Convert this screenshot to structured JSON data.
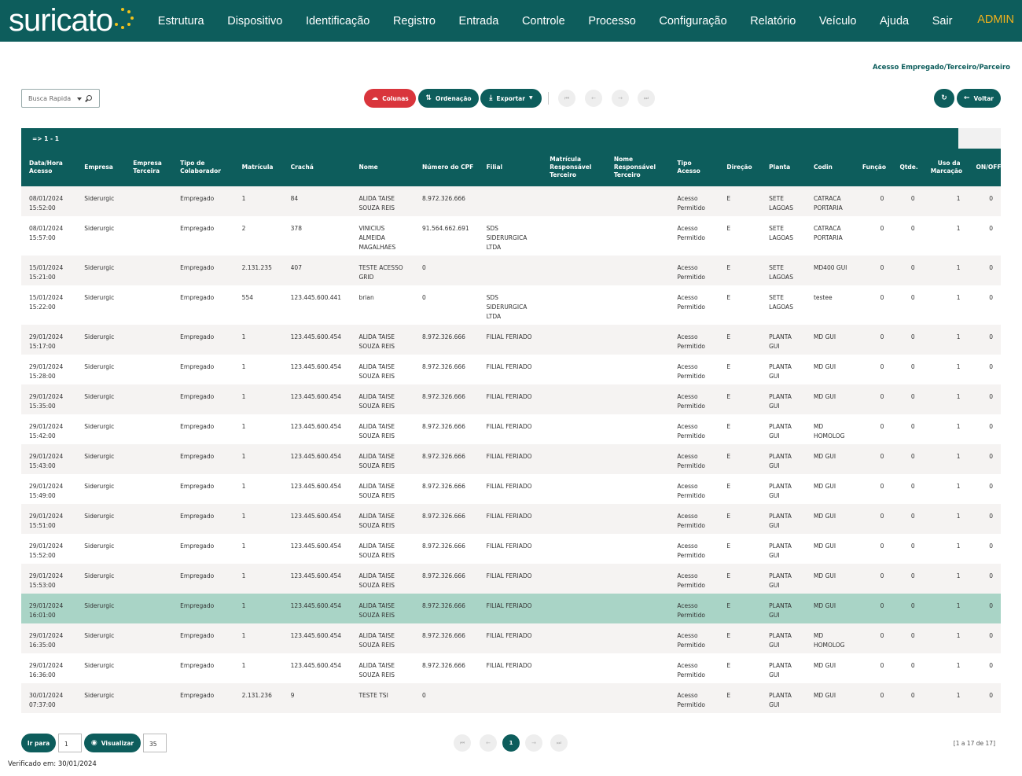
{
  "app": {
    "brand": "suricato",
    "nav": [
      "Estrutura",
      "Dispositivo",
      "Identificação",
      "Registro",
      "Entrada",
      "Controle",
      "Processo",
      "Configuração",
      "Relatório",
      "Veículo",
      "Ajuda",
      "Sair"
    ],
    "user": "ADMIN",
    "accent": "#0d5d5c",
    "highlight": "#f4b21b"
  },
  "page": {
    "subtitle": "Acesso Empregado/Terceiro/Parceiro"
  },
  "toolbar": {
    "search_placeholder": "Busca Rapida",
    "columns": "Colunas",
    "order": "Ordenação",
    "export": "Exportar",
    "back": "Voltar"
  },
  "table": {
    "range": "=> 1 - 1",
    "headers": [
      "Data/Hora Acesso",
      "Empresa",
      "Empresa Terceira",
      "Tipo de Colaborador",
      "Matrícula",
      "Crachá",
      "Nome",
      "Número do CPF",
      "Filial",
      "Matrícula Responsável Terceiro",
      "Nome Responsável Terceiro",
      "Tipo Acesso",
      "Direção",
      "Planta",
      "Codin",
      "Função",
      "Qtde.",
      "Uso da Marcação",
      "ON/OFF"
    ],
    "rows": [
      [
        "08/01/2024 15:52:00",
        "Siderurgic",
        "",
        "Empregado",
        "1",
        "84",
        "ALIDA TAISE SOUZA REIS",
        "8.972.326.666",
        "",
        "",
        "",
        "Acesso Permitido",
        "E",
        "SETE LAGOAS",
        "CATRACA PORTARIA",
        "0",
        "0",
        "1",
        "0"
      ],
      [
        "08/01/2024 15:57:00",
        "Siderurgic",
        "",
        "Empregado",
        "2",
        "378",
        "VINICIUS ALMEIDA MAGALHAES",
        "91.564.662.691",
        "SDS SIDERURGICA LTDA",
        "",
        "",
        "Acesso Permitido",
        "E",
        "SETE LAGOAS",
        "CATRACA PORTARIA",
        "0",
        "0",
        "1",
        "0"
      ],
      [
        "15/01/2024 15:21:00",
        "Siderurgic",
        "",
        "Empregado",
        "2.131.235",
        "407",
        "TESTE ACESSO GRID",
        "0",
        "",
        "",
        "",
        "Acesso Permitido",
        "E",
        "SETE LAGOAS",
        "MD400 GUI",
        "0",
        "0",
        "1",
        "0"
      ],
      [
        "15/01/2024 15:22:00",
        "Siderurgic",
        "",
        "Empregado",
        "554",
        "123.445.600.441",
        "brian",
        "0",
        "SDS SIDERURGICA LTDA",
        "",
        "",
        "Acesso Permitido",
        "E",
        "SETE LAGOAS",
        "testee",
        "0",
        "0",
        "1",
        "0"
      ],
      [
        "29/01/2024 15:17:00",
        "Siderurgic",
        "",
        "Empregado",
        "1",
        "123.445.600.454",
        "ALIDA TAISE SOUZA REIS",
        "8.972.326.666",
        "FILIAL FERIADO",
        "",
        "",
        "Acesso Permitido",
        "E",
        "PLANTA GUI",
        "MD GUI",
        "0",
        "0",
        "1",
        "0"
      ],
      [
        "29/01/2024 15:28:00",
        "Siderurgic",
        "",
        "Empregado",
        "1",
        "123.445.600.454",
        "ALIDA TAISE SOUZA REIS",
        "8.972.326.666",
        "FILIAL FERIADO",
        "",
        "",
        "Acesso Permitido",
        "E",
        "PLANTA GUI",
        "MD GUI",
        "0",
        "0",
        "1",
        "0"
      ],
      [
        "29/01/2024 15:35:00",
        "Siderurgic",
        "",
        "Empregado",
        "1",
        "123.445.600.454",
        "ALIDA TAISE SOUZA REIS",
        "8.972.326.666",
        "FILIAL FERIADO",
        "",
        "",
        "Acesso Permitido",
        "E",
        "PLANTA GUI",
        "MD GUI",
        "0",
        "0",
        "1",
        "0"
      ],
      [
        "29/01/2024 15:42:00",
        "Siderurgic",
        "",
        "Empregado",
        "1",
        "123.445.600.454",
        "ALIDA TAISE SOUZA REIS",
        "8.972.326.666",
        "FILIAL FERIADO",
        "",
        "",
        "Acesso Permitido",
        "E",
        "PLANTA GUI",
        "MD HOMOLOG",
        "0",
        "0",
        "1",
        "0"
      ],
      [
        "29/01/2024 15:43:00",
        "Siderurgic",
        "",
        "Empregado",
        "1",
        "123.445.600.454",
        "ALIDA TAISE SOUZA REIS",
        "8.972.326.666",
        "FILIAL FERIADO",
        "",
        "",
        "Acesso Permitido",
        "E",
        "PLANTA GUI",
        "MD GUI",
        "0",
        "0",
        "1",
        "0"
      ],
      [
        "29/01/2024 15:49:00",
        "Siderurgic",
        "",
        "Empregado",
        "1",
        "123.445.600.454",
        "ALIDA TAISE SOUZA REIS",
        "8.972.326.666",
        "FILIAL FERIADO",
        "",
        "",
        "Acesso Permitido",
        "E",
        "PLANTA GUI",
        "MD GUI",
        "0",
        "0",
        "1",
        "0"
      ],
      [
        "29/01/2024 15:51:00",
        "Siderurgic",
        "",
        "Empregado",
        "1",
        "123.445.600.454",
        "ALIDA TAISE SOUZA REIS",
        "8.972.326.666",
        "FILIAL FERIADO",
        "",
        "",
        "Acesso Permitido",
        "E",
        "PLANTA GUI",
        "MD GUI",
        "0",
        "0",
        "1",
        "0"
      ],
      [
        "29/01/2024 15:52:00",
        "Siderurgic",
        "",
        "Empregado",
        "1",
        "123.445.600.454",
        "ALIDA TAISE SOUZA REIS",
        "8.972.326.666",
        "FILIAL FERIADO",
        "",
        "",
        "Acesso Permitido",
        "E",
        "PLANTA GUI",
        "MD GUI",
        "0",
        "0",
        "1",
        "0"
      ],
      [
        "29/01/2024 15:53:00",
        "Siderurgic",
        "",
        "Empregado",
        "1",
        "123.445.600.454",
        "ALIDA TAISE SOUZA REIS",
        "8.972.326.666",
        "FILIAL FERIADO",
        "",
        "",
        "Acesso Permitido",
        "E",
        "PLANTA GUI",
        "MD GUI",
        "0",
        "0",
        "1",
        "0"
      ],
      [
        "29/01/2024 16:01:00",
        "Siderurgic",
        "",
        "Empregado",
        "1",
        "123.445.600.454",
        "ALIDA TAISE SOUZA REIS",
        "8.972.326.666",
        "FILIAL FERIADO",
        "",
        "",
        "Acesso Permitido",
        "E",
        "PLANTA GUI",
        "MD GUI",
        "0",
        "0",
        "1",
        "0"
      ],
      [
        "29/01/2024 16:35:00",
        "Siderurgic",
        "",
        "Empregado",
        "1",
        "123.445.600.454",
        "ALIDA TAISE SOUZA REIS",
        "8.972.326.666",
        "FILIAL FERIADO",
        "",
        "",
        "Acesso Permitido",
        "E",
        "PLANTA GUI",
        "MD HOMOLOG",
        "0",
        "0",
        "1",
        "0"
      ],
      [
        "29/01/2024 16:36:00",
        "Siderurgic",
        "",
        "Empregado",
        "1",
        "123.445.600.454",
        "ALIDA TAISE SOUZA REIS",
        "8.972.326.666",
        "FILIAL FERIADO",
        "",
        "",
        "Acesso Permitido",
        "E",
        "PLANTA GUI",
        "MD GUI",
        "0",
        "0",
        "1",
        "0"
      ],
      [
        "30/01/2024 07:37:00",
        "Siderurgic",
        "",
        "Empregado",
        "2.131.236",
        "9",
        "TESTE TSI",
        "0",
        "",
        "",
        "",
        "Acesso Permitido",
        "E",
        "PLANTA GUI",
        "MD GUI",
        "0",
        "0",
        "1",
        "0"
      ]
    ],
    "selected_row": 13,
    "selected_color": "#a9d4c6"
  },
  "footer": {
    "goto_label": "Ir para",
    "goto_value": "1",
    "view_label": "Visualizar",
    "view_value": "35",
    "current_page": "1",
    "count": "[1 a 17 de 17]",
    "verified": "Verificado em: 30/01/2024"
  }
}
